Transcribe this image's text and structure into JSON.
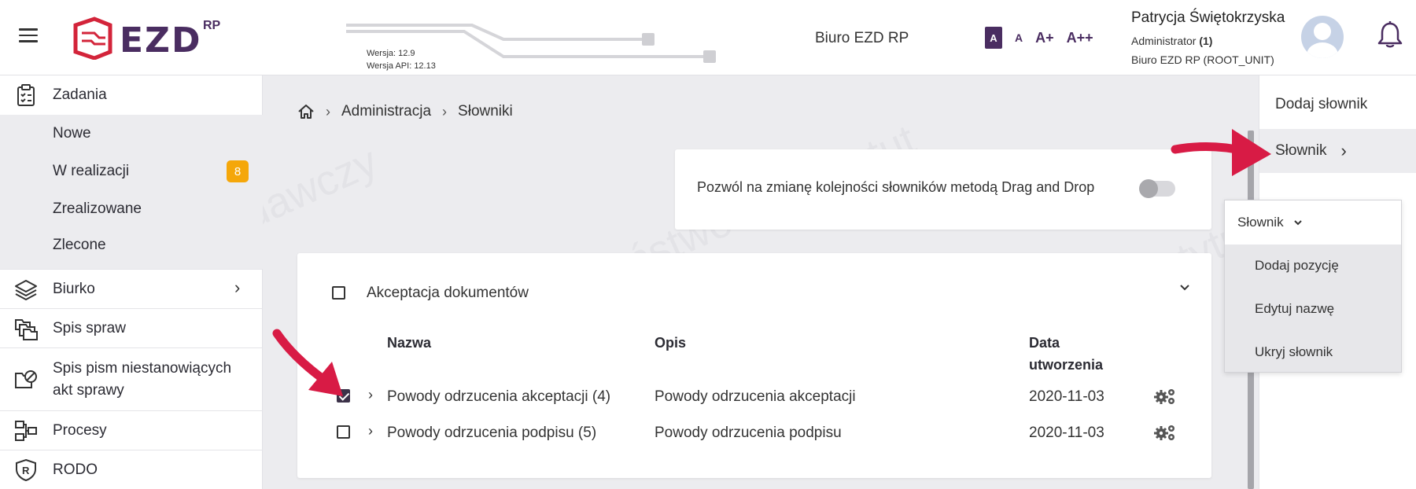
{
  "header": {
    "logo_text": "EZD",
    "logo_sup": "RP",
    "version": "Wersja: 12.9",
    "api_version": "Wersja API: 12.13",
    "org_title": "Biuro EZD RP",
    "font_sizes": [
      "A",
      "A",
      "A+",
      "A++"
    ],
    "user": {
      "name": "Patrycja Świętokrzyska",
      "role": "Administrator",
      "role_count": "(1)",
      "unit": "Biuro EZD RP (ROOT_UNIT)"
    },
    "icons": [
      "hamburger-icon",
      "user-avatar-icon",
      "bell-icon"
    ]
  },
  "sidebar": {
    "items": [
      {
        "label": "Zadania",
        "icon": "clipboard-icon"
      },
      {
        "label": "Nowe"
      },
      {
        "label": "W realizacji",
        "badge": "8"
      },
      {
        "label": "Zrealizowane"
      },
      {
        "label": "Zlecone"
      },
      {
        "label": "Biurko",
        "icon": "layers-icon"
      },
      {
        "label": "Spis spraw",
        "icon": "folders-icon"
      },
      {
        "label": "Spis pism niestanowiących akt sprawy",
        "icon": "folder-blocked-icon"
      },
      {
        "label": "Procesy",
        "icon": "process-icon"
      },
      {
        "label": "RODO",
        "icon": "shield-r-icon"
      }
    ]
  },
  "breadcrumb": {
    "items": [
      "Administracja",
      "Słowniki"
    ]
  },
  "drag_drop": {
    "label": "Pozwól na zmianę kolejności słowników metodą Drag and Drop",
    "enabled": false
  },
  "table": {
    "group_label": "Akceptacja dokumentów",
    "headers": {
      "name": "Nazwa",
      "desc": "Opis",
      "date_line1": "Data",
      "date_line2": "utworzenia"
    },
    "rows": [
      {
        "name": "Powody odrzucenia akceptacji (4)",
        "desc": "Powody odrzucenia akceptacji",
        "date": "2020-11-03",
        "checked": true
      },
      {
        "name": "Powody odrzucenia podpisu (5)",
        "desc": "Powody odrzucenia podpisu",
        "date": "2020-11-03",
        "checked": false
      }
    ]
  },
  "right_panel": {
    "items": [
      "Dodaj słownik",
      "Słownik"
    ],
    "menu": {
      "title": "Słownik",
      "items": [
        "Dodaj pozycję",
        "Edytuj nazwę",
        "Ukryj słownik"
      ]
    }
  },
  "colors": {
    "brand": "#4a2d61",
    "logo_red": "#d3243a",
    "badge": "#f5a70a",
    "arrow": "#d81b45"
  }
}
